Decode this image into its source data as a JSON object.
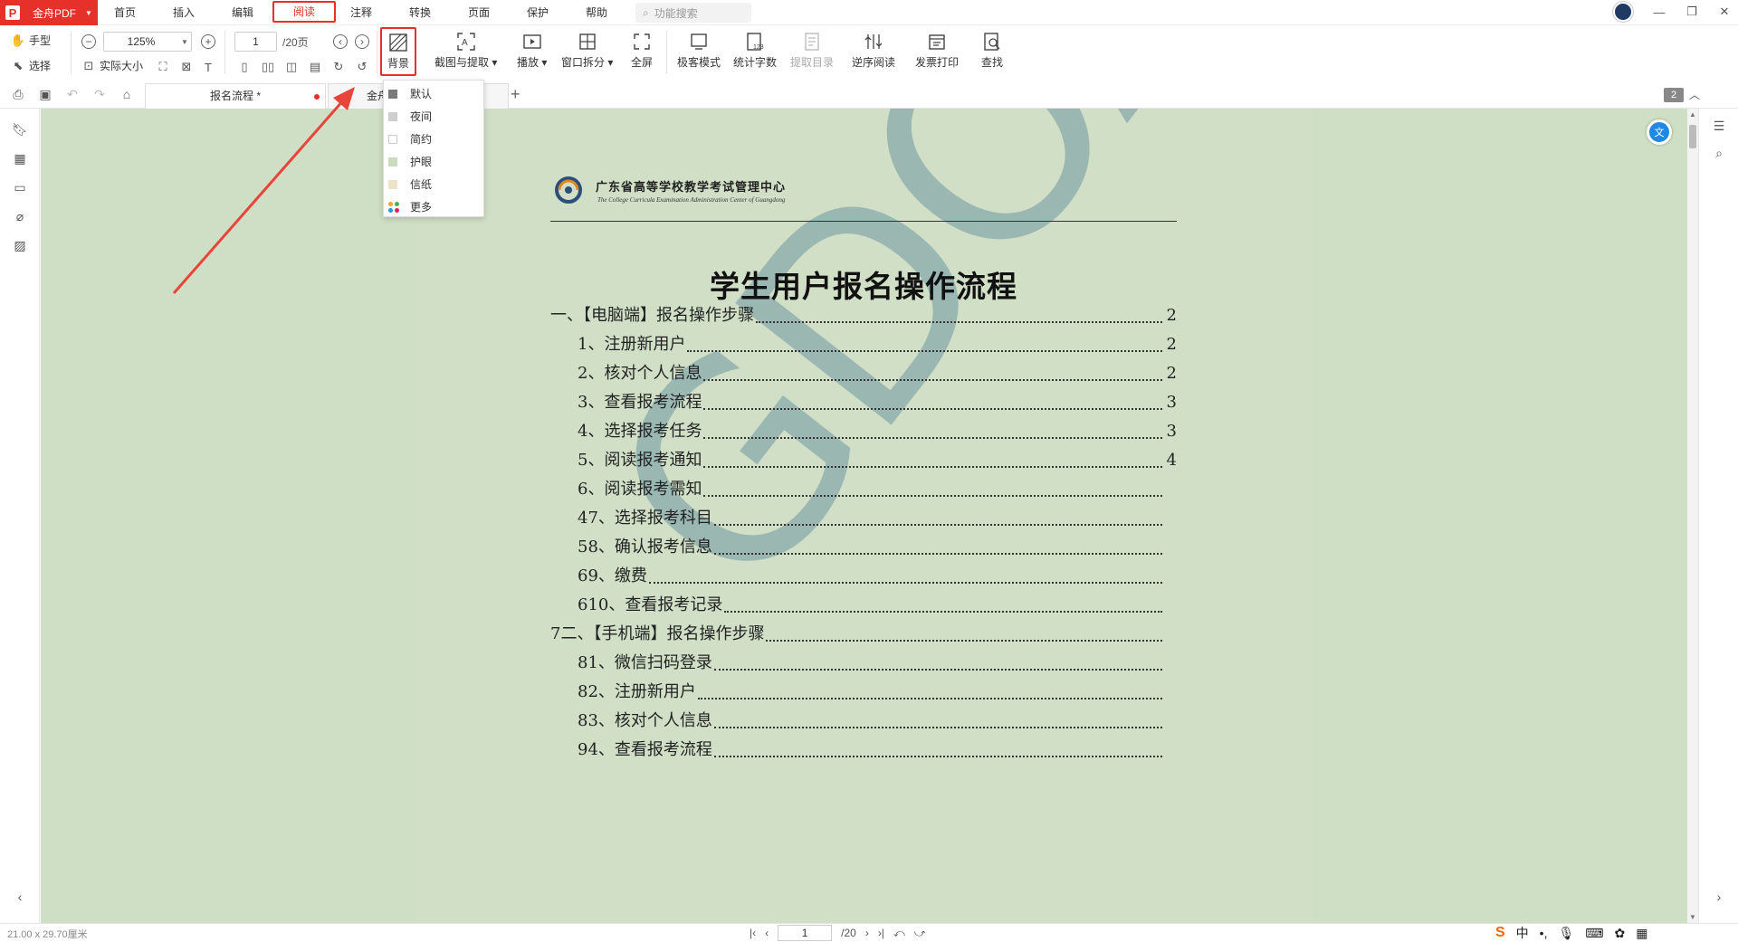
{
  "app": {
    "name": "金舟PDF"
  },
  "menu": {
    "tabs": [
      "首页",
      "插入",
      "编辑",
      "阅读",
      "注释",
      "转换",
      "页面",
      "保护",
      "帮助"
    ],
    "active": "阅读",
    "search_placeholder": "功能搜索"
  },
  "ribbon": {
    "hand": "手型",
    "select": "选择",
    "actual_size": "实际大小",
    "zoom": "125%",
    "page_current": "1",
    "page_total": "/20页",
    "buttons": {
      "background": "背景",
      "screenshot": "截图与提取",
      "play": "播放",
      "split": "窗口拆分",
      "fullscreen": "全屏",
      "minimal": "极客模式",
      "wordcount": "统计字数",
      "extract_toc": "提取目录",
      "reverse": "逆序阅读",
      "invoice": "发票打印",
      "find": "查找"
    }
  },
  "background_menu": {
    "items": [
      {
        "label": "默认",
        "color": "#7a7a7a"
      },
      {
        "label": "夜间",
        "color": "#cfcfcf"
      },
      {
        "label": "简约",
        "color": "#ffffff"
      },
      {
        "label": "护眼",
        "color": "#c9dcbf"
      },
      {
        "label": "信纸",
        "color": "#efe3c7"
      },
      {
        "label": "更多",
        "color": ""
      }
    ]
  },
  "tabs": {
    "doc1": "报名流程 *",
    "doc2": "金舟",
    "page_badge": "2"
  },
  "document": {
    "org_cn": "广东省高等学校教学考试管理中心",
    "org_en": "The College Curricula Examination Administration Center of Guangdong",
    "title": "学生用户报名操作流程",
    "watermark": "GDOA",
    "toc": [
      {
        "text": "一、【电脑端】报名操作步骤",
        "page": "2",
        "indent": 0
      },
      {
        "text": "1、注册新用户",
        "page": "2",
        "indent": 1
      },
      {
        "text": "2、核对个人信息",
        "page": "2",
        "indent": 1
      },
      {
        "text": "3、查看报考流程",
        "page": "3",
        "indent": 1
      },
      {
        "text": "4、选择报考任务",
        "page": "3",
        "indent": 1
      },
      {
        "text": "5、阅读报考通知",
        "page": "4",
        "indent": 1
      },
      {
        "text": "6、阅读报考需知",
        "page": "",
        "indent": 1
      },
      {
        "text": "47、选择报考科目",
        "page": "",
        "indent": 1
      },
      {
        "text": "58、确认报考信息",
        "page": "",
        "indent": 1
      },
      {
        "text": "69、缴费",
        "page": "",
        "indent": 1
      },
      {
        "text": "610、查看报考记录",
        "page": "",
        "indent": 1
      },
      {
        "text": "7二、【手机端】报名操作步骤",
        "page": "",
        "indent": 0
      },
      {
        "text": "81、微信扫码登录",
        "page": "",
        "indent": 1
      },
      {
        "text": "82、注册新用户",
        "page": "",
        "indent": 1
      },
      {
        "text": "83、核对个人信息",
        "page": "",
        "indent": 1
      },
      {
        "text": "94、查看报考流程",
        "page": "",
        "indent": 1
      }
    ]
  },
  "status": {
    "dims": "21.00 x 29.70厘米",
    "page_current": "1",
    "page_total": "/20",
    "ime_lang": "中"
  }
}
